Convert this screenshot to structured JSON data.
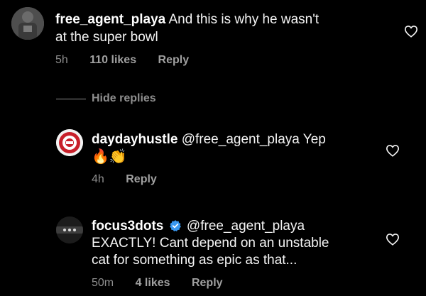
{
  "comments": [
    {
      "username": "free_agent_playa",
      "text_line1": "And this is why he wasn't",
      "text_line2": "at the super bowl",
      "time": "5h",
      "likes": "110 likes",
      "reply": "Reply"
    }
  ],
  "replies_toggle": {
    "label": "Hide replies"
  },
  "replies": [
    {
      "username": "daydayhustle",
      "mention": "@free_agent_playa",
      "text": "Yep",
      "emojis": [
        "fire",
        "clapping-hands"
      ],
      "emoji_glyphs": "🔥👏",
      "time": "4h",
      "reply": "Reply"
    },
    {
      "username": "focus3dots",
      "verified": true,
      "mention": "@free_agent_playa",
      "text_line1": "EXACTLY! Cant depend on an unstable",
      "text_line2": "cat for something as epic as that...",
      "time": "50m",
      "likes": "4 likes",
      "reply": "Reply"
    }
  ],
  "colors": {
    "background": "#000000",
    "text": "#f5f5f5",
    "meta": "#8e8e8e",
    "verified_badge": "#3897f0"
  },
  "icons": {
    "like": "heart-outline-icon",
    "verified": "verified-badge-icon"
  }
}
